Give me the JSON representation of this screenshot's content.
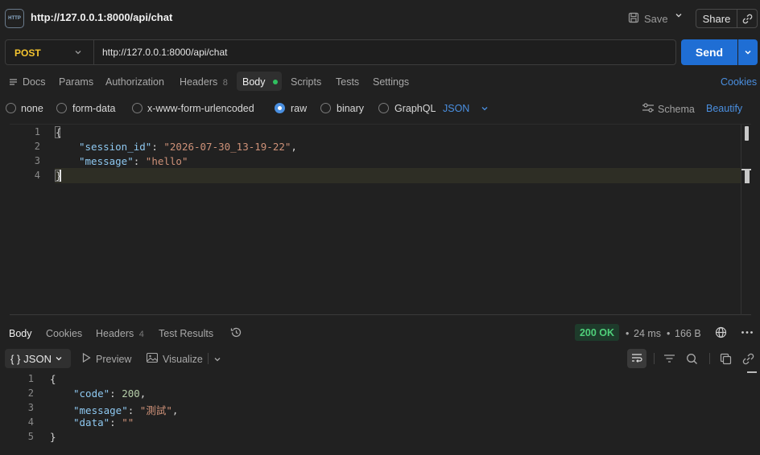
{
  "header": {
    "icon_text": "HTTP",
    "title": "http://127.0.0.1:8000/api/chat",
    "save_label": "Save",
    "share_label": "Share"
  },
  "request": {
    "method": "POST",
    "url": "http://127.0.0.1:8000/api/chat",
    "send_label": "Send"
  },
  "tabs": {
    "docs": "Docs",
    "params": "Params",
    "authorization": "Authorization",
    "headers": "Headers",
    "headers_count": "8",
    "body": "Body",
    "scripts": "Scripts",
    "tests": "Tests",
    "settings": "Settings",
    "cookies": "Cookies"
  },
  "body_types": {
    "none": "none",
    "form_data": "form-data",
    "urlencoded": "x-www-form-urlencoded",
    "raw": "raw",
    "binary": "binary",
    "graphql": "GraphQL",
    "selected": "raw",
    "raw_format": "JSON",
    "schema": "Schema",
    "beautify": "Beautify"
  },
  "editor": {
    "line_numbers": [
      "1",
      "2",
      "3",
      "4"
    ],
    "open_brace": "{",
    "close_brace": "}",
    "fields": [
      {
        "key": "\"session_id\"",
        "value": "\"2026-07-30_13-19-22\"",
        "trail": ","
      },
      {
        "key": "\"message\"",
        "value": "\"hello\"",
        "trail": ""
      }
    ]
  },
  "response": {
    "tabs": {
      "body": "Body",
      "cookies": "Cookies",
      "headers": "Headers",
      "headers_count": "4",
      "test_results": "Test Results"
    },
    "status": "200 OK",
    "time": "24 ms",
    "size": "166 B",
    "format_braces": "{ }",
    "format": "JSON",
    "preview": "Preview",
    "visualize": "Visualize",
    "line_numbers": [
      "1",
      "2",
      "3",
      "4",
      "5"
    ],
    "open_brace": "{",
    "close_brace": "}",
    "fields": [
      {
        "key": "\"code\"",
        "value": "200",
        "trail": ","
      },
      {
        "key": "\"message\"",
        "value": "\"測試\"",
        "trail": ","
      },
      {
        "key": "\"data\"",
        "value": "\"\"",
        "trail": ""
      }
    ]
  },
  "colors": {
    "accent": "#1f6ed4",
    "link": "#4a8fe0",
    "method": "#f4c430",
    "status_ok": "#4fcf7a",
    "json_key": "#8ec8f0",
    "json_string": "#ce9178",
    "json_number": "#b5cea8"
  }
}
